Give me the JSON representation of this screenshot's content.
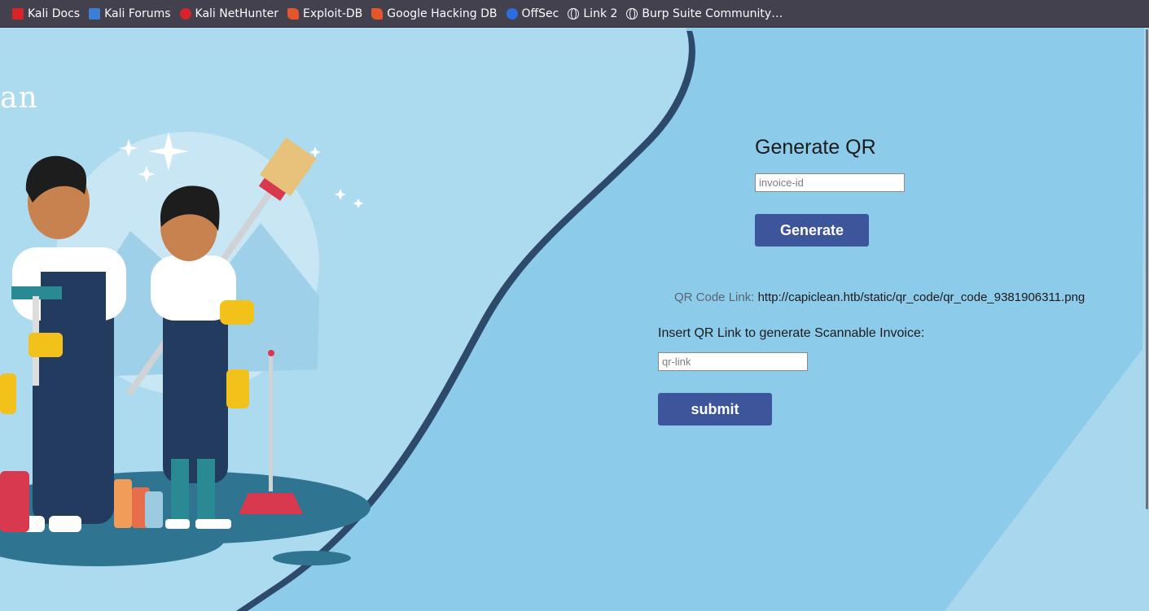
{
  "bookmarks": [
    {
      "label": "Kali Docs",
      "icon": "kali-icon"
    },
    {
      "label": "Kali Forums",
      "icon": "kali-forums-icon"
    },
    {
      "label": "Kali NetHunter",
      "icon": "nethunter-icon"
    },
    {
      "label": "Exploit-DB",
      "icon": "exploit-db-icon"
    },
    {
      "label": "Google Hacking DB",
      "icon": "ghdb-icon"
    },
    {
      "label": "OffSec",
      "icon": "offsec-icon"
    },
    {
      "label": "Link 2",
      "icon": "globe-icon"
    },
    {
      "label": "Burp Suite Community…",
      "icon": "globe-icon"
    }
  ],
  "hero": {
    "brand_fragment": "an"
  },
  "generate": {
    "title": "Generate QR",
    "input_placeholder": "invoice-id",
    "button_label": "Generate"
  },
  "qr": {
    "link_label": "QR Code Link:",
    "link_url": "http://capiclean.htb/static/qr_code/qr_code_9381906311.png"
  },
  "scan": {
    "label": "Insert QR Link to generate Scannable Invoice:",
    "input_placeholder": "qr-link",
    "button_label": "submit"
  },
  "colors": {
    "page_bg": "#8ccbea",
    "left_panel": "#acdaee",
    "button": "#3d559a",
    "bookmark_bar": "#42414d"
  }
}
